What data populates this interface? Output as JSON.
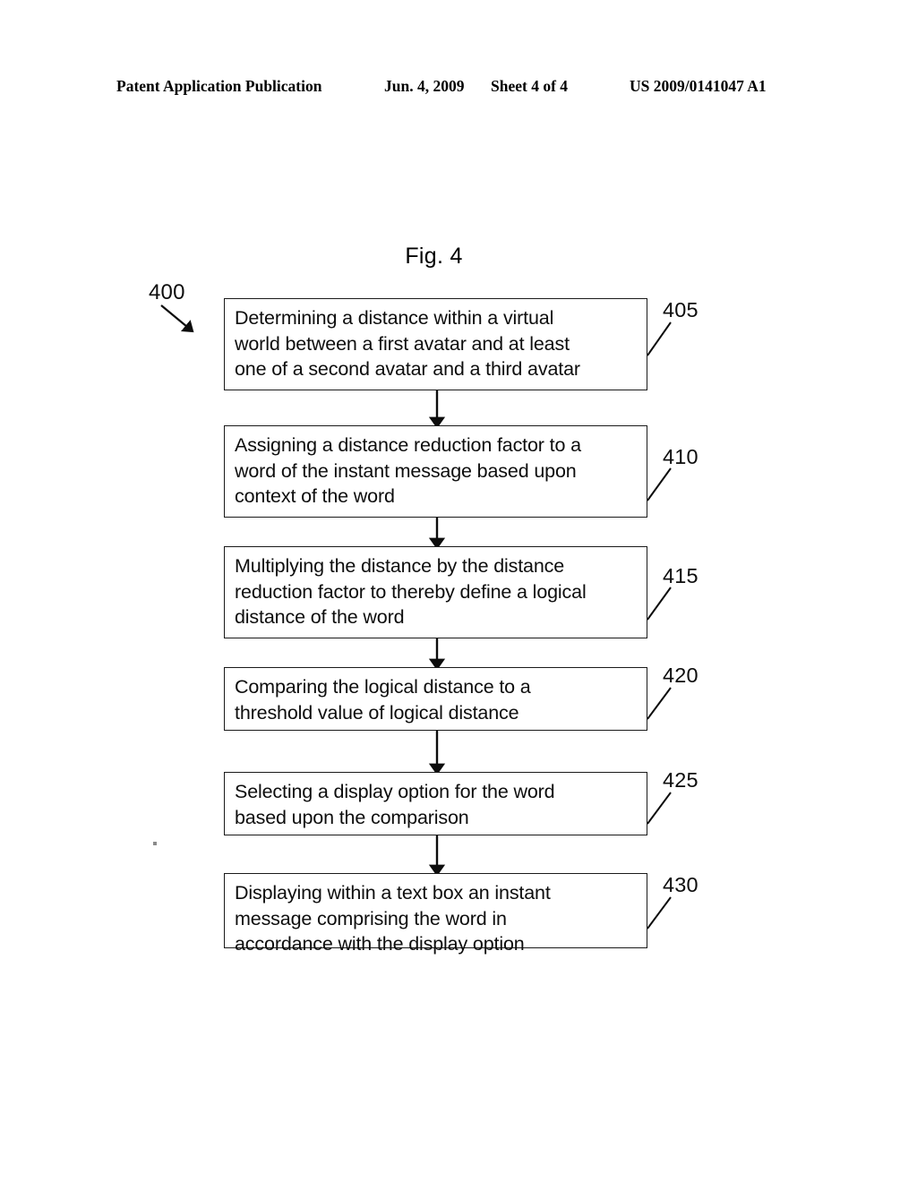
{
  "header": {
    "publication": "Patent Application Publication",
    "date": "Jun. 4, 2009",
    "sheet": "Sheet 4 of 4",
    "patent_number": "US 2009/0141047 A1"
  },
  "figure": {
    "caption": "Fig. 4",
    "diagram_reference": "400"
  },
  "flowchart": {
    "steps": [
      {
        "ref": "405",
        "text": "Determining a distance within a virtual\nworld between a first avatar and at least\none of a second avatar and a third avatar"
      },
      {
        "ref": "410",
        "text": "Assigning a distance reduction factor to a\nword of the instant message based upon\ncontext of the word"
      },
      {
        "ref": "415",
        "text": "Multiplying the distance by the distance\nreduction factor to thereby define a logical\ndistance of the word"
      },
      {
        "ref": "420",
        "text": "Comparing the logical distance to a\nthreshold value of logical distance"
      },
      {
        "ref": "425",
        "text": "Selecting a display option for the word\nbased upon the comparison"
      },
      {
        "ref": "430",
        "text": "Displaying within a text box an instant\nmessage comprising the word in\naccordance with the display option"
      }
    ]
  },
  "colors": {
    "ink": "#0d0d0d",
    "page": "#ffffff"
  }
}
